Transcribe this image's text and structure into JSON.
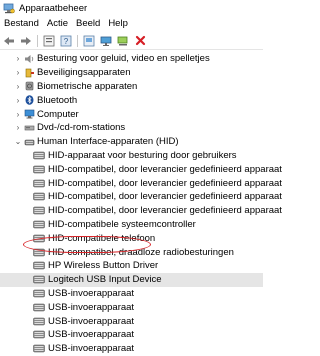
{
  "window": {
    "title": "Apparaatbeheer"
  },
  "menu": {
    "items": [
      "Bestand",
      "Actie",
      "Beeld",
      "Help"
    ]
  },
  "toolbar": {
    "buttons": [
      "back-icon",
      "forward-icon",
      "properties-icon",
      "help-icon",
      "update-icon",
      "monitor-icon",
      "scan-icon",
      "delete-icon"
    ]
  },
  "tree": {
    "items": [
      {
        "label": "Besturing voor geluid, video en spelletjes",
        "icon": "speaker-icon",
        "expanded": false
      },
      {
        "label": "Beveiligingsapparaten",
        "icon": "security-key-icon",
        "expanded": false
      },
      {
        "label": "Biometrische apparaten",
        "icon": "biometric-icon",
        "expanded": false
      },
      {
        "label": "Bluetooth",
        "icon": "bluetooth-icon",
        "expanded": false
      },
      {
        "label": "Computer",
        "icon": "computer-icon",
        "expanded": false
      },
      {
        "label": "Dvd-/cd-rom-stations",
        "icon": "dvd-icon",
        "expanded": false
      },
      {
        "label": "Human Interface-apparaten (HID)",
        "icon": "hid-category-icon",
        "expanded": true
      },
      {
        "label": "HID-apparaat voor besturing door gebruikers",
        "icon": "hid-device-icon"
      },
      {
        "label": "HID-compatibel, door leverancier gedefinieerd apparaat",
        "icon": "hid-device-icon"
      },
      {
        "label": "HID-compatibel, door leverancier gedefinieerd apparaat",
        "icon": "hid-device-icon"
      },
      {
        "label": "HID-compatibel, door leverancier gedefinieerd apparaat",
        "icon": "hid-device-icon"
      },
      {
        "label": "HID-compatibel, door leverancier gedefinieerd apparaat",
        "icon": "hid-device-icon"
      },
      {
        "label": "HID-compatibele systeemcontroller",
        "icon": "hid-device-icon"
      },
      {
        "label": "HID-compatibele telefoon",
        "icon": "hid-device-icon"
      },
      {
        "label": "HID-compatibel, draadloze radiobesturingen",
        "icon": "hid-device-icon"
      },
      {
        "label": "HP Wireless Button Driver",
        "icon": "hid-device-icon"
      },
      {
        "label": "Logitech USB Input Device",
        "icon": "hid-device-icon",
        "selected": true
      },
      {
        "label": "USB-invoerapparaat",
        "icon": "hid-device-icon"
      },
      {
        "label": "USB-invoerapparaat",
        "icon": "hid-device-icon"
      },
      {
        "label": "USB-invoerapparaat",
        "icon": "hid-device-icon"
      },
      {
        "label": "USB-invoerapparaat",
        "icon": "hid-device-icon"
      },
      {
        "label": "USB-invoerapparaat",
        "icon": "hid-device-icon"
      }
    ]
  },
  "colors": {
    "annotation": "#d9262b",
    "selection": "#e5e5e5"
  }
}
